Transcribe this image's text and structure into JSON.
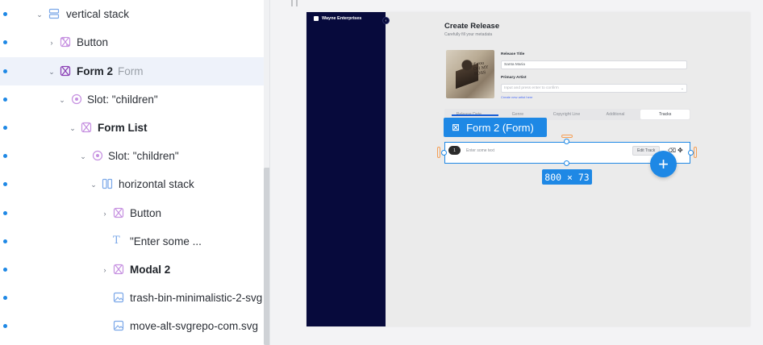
{
  "tree": {
    "rows": [
      {
        "label": "vertical stack",
        "sub": "",
        "icon": "vertical-stack-icon"
      },
      {
        "label": "Button",
        "sub": "",
        "icon": "component-icon"
      },
      {
        "label": "Form 2",
        "sub": "Form",
        "icon": "component-icon"
      },
      {
        "label": "Slot: \"children\"",
        "sub": "",
        "icon": "slot-icon"
      },
      {
        "label": "Form List",
        "sub": "",
        "icon": "component-icon"
      },
      {
        "label": "Slot: \"children\"",
        "sub": "",
        "icon": "slot-icon"
      },
      {
        "label": "horizontal stack",
        "sub": "",
        "icon": "horizontal-stack-icon"
      },
      {
        "label": "Button",
        "sub": "",
        "icon": "component-icon"
      },
      {
        "label": "\"Enter some ...",
        "sub": "",
        "icon": "text-icon"
      },
      {
        "label": "Modal 2",
        "sub": "",
        "icon": "component-icon"
      },
      {
        "label": "trash-bin-minimalistic-2-svg",
        "sub": "",
        "icon": "image-icon"
      },
      {
        "label": "move-alt-svgrepo-com.svg",
        "sub": "",
        "icon": "image-icon"
      }
    ]
  },
  "app": {
    "brand": "Wayne Enterprises",
    "collapse_glyph": "‹",
    "title": "Create Release",
    "subtitle": "Carefully fill your metadata",
    "cover_text": "if you\nOH MY\nBOSS",
    "release_title_label": "Release Title",
    "release_title_value": "Santa Maria",
    "primary_artist_label": "Primary Artist",
    "primary_artist_placeholder": "Input and press enter to confirm",
    "create_link": "Create new artist here",
    "tabs": [
      "Release Date",
      "Genre",
      "Copyright Line",
      "Additional",
      "Tracks"
    ],
    "active_tab": "Tracks",
    "row_badge": "1",
    "row_placeholder": "Enter some text",
    "row_edit": "Edit Track"
  },
  "overlay": {
    "selection_label": "Form 2 (Form)",
    "dimensions": "800 × 73",
    "add_button": "+"
  },
  "colors": {
    "accent": "#1e88e5",
    "sidebar_bg": "#070a3c",
    "handle_orange": "#f59e54"
  }
}
